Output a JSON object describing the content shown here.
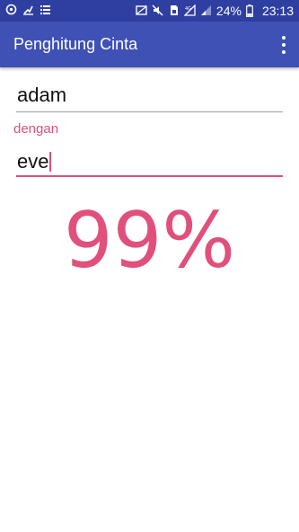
{
  "status_bar": {
    "battery": "24%",
    "time": "23:13",
    "background": "#2f3fa1",
    "left_icons": [
      "sync-icon",
      "tethering-icon",
      "list-icon"
    ],
    "right_icons": [
      "cast-icon",
      "mute-icon",
      "sim-icon",
      "signal-4g-icon",
      "signal-icon"
    ]
  },
  "app_bar": {
    "title": "Penghitung Cinta",
    "background": "#3f51b5",
    "menu_icon": "overflow-menu-icon"
  },
  "form": {
    "name_1": "adam",
    "label": "dengan",
    "name_2": "eve"
  },
  "result": {
    "percentage": "99%",
    "color": "#e0507a"
  }
}
